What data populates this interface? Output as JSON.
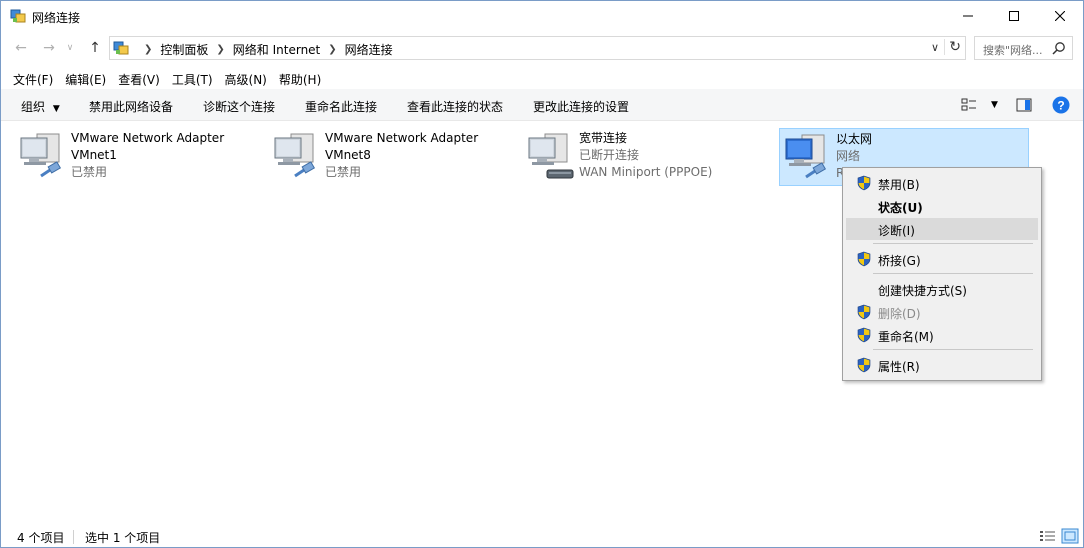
{
  "window": {
    "title": "网络连接"
  },
  "address": {
    "crumbs": [
      "控制面板",
      "网络和 Internet",
      "网络连接"
    ],
    "search_placeholder": "搜索\"网络..."
  },
  "menubar": [
    "文件(F)",
    "编辑(E)",
    "查看(V)",
    "工具(T)",
    "高级(N)",
    "帮助(H)"
  ],
  "commands": {
    "organize": "组织",
    "disable": "禁用此网络设备",
    "diagnose": "诊断这个连接",
    "rename": "重命名此连接",
    "status": "查看此连接的状态",
    "settings": "更改此连接的设置"
  },
  "items": [
    {
      "name": "VMware Network Adapter",
      "sub": "VMnet1",
      "status": "已禁用"
    },
    {
      "name": "VMware Network Adapter",
      "sub": "VMnet8",
      "status": "已禁用"
    },
    {
      "name": "宽带连接",
      "sub": "已断开连接",
      "status": "WAN Miniport (PPPOE)"
    },
    {
      "name": "以太网",
      "sub": "网络",
      "status": "R"
    }
  ],
  "context_menu": {
    "disable": "禁用(B)",
    "status": "状态(U)",
    "diagnose": "诊断(I)",
    "bridge": "桥接(G)",
    "shortcut": "创建快捷方式(S)",
    "delete": "删除(D)",
    "rename": "重命名(M)",
    "properties": "属性(R)"
  },
  "statusbar": {
    "count": "4 个项目",
    "selected": "选中 1 个项目"
  },
  "colors": {
    "selection": "#cce8ff",
    "help": "#1a73e8",
    "shield_blue": "#2b62c0",
    "shield_yellow": "#f2c811"
  }
}
